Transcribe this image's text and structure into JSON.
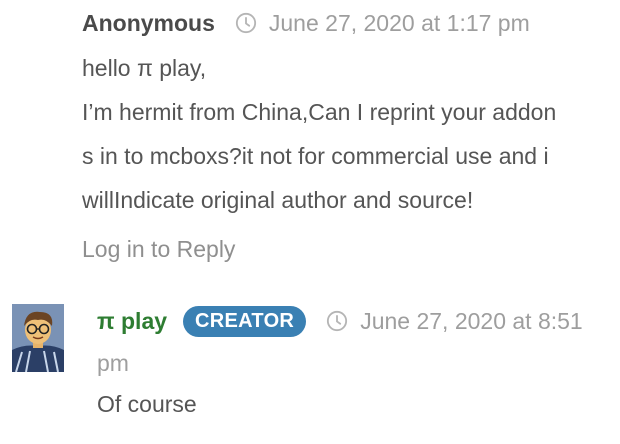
{
  "comment1": {
    "author": "Anonymous",
    "date": "June 27, 2020 at 1:17 pm",
    "lines": [
      "hello π play,",
      "I’m hermit from China,Can I reprint your addon",
      "s in to mcboxs?it not for commercial use and i",
      "willIndicate original author and source!"
    ],
    "reply": "Log in to Reply"
  },
  "comment2": {
    "author": "π play",
    "badge": "CREATOR",
    "date_start": "June 27, 2020 at 8:51",
    "date_end": "pm",
    "text": "Of course"
  },
  "icons": {
    "clock": "clock-icon",
    "avatar": "avatar-image"
  },
  "colors": {
    "creator_badge": "#3a80b3",
    "author_green": "#2e7d32"
  }
}
